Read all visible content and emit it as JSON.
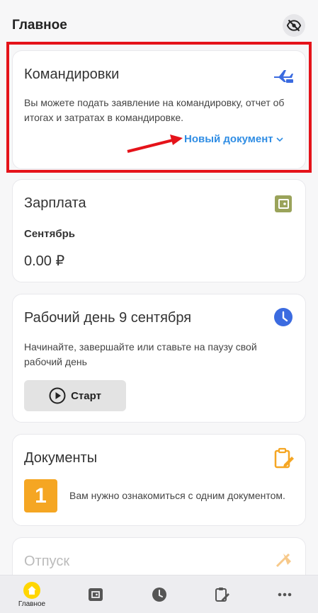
{
  "header": {
    "title": "Главное",
    "eye_icon": "eye-off-icon"
  },
  "trips_card": {
    "title": "Командировки",
    "text": "Вы можете подать заявление на командировку, отчет об итогах и затратах в командировке.",
    "new_doc_label": "Новый документ",
    "icon": "airplane-icon",
    "accent": "#2f8de4"
  },
  "salary_card": {
    "title": "Зарплата",
    "month": "Сентябрь",
    "amount": "0.00 ₽",
    "icon": "wallet-icon",
    "icon_color": "#9aa35a"
  },
  "workday_card": {
    "title": "Рабочий день 9 сентября",
    "text": "Начинайте, завершайте или ставьте на паузу свой рабочий день",
    "start_label": "Старт",
    "icon": "clock-icon",
    "icon_color": "#3b6be0"
  },
  "documents_card": {
    "title": "Документы",
    "count": "1",
    "text": "Вам нужно ознакомиться с одним документом.",
    "icon": "clipboard-edit-icon",
    "badge_color": "#f5a623"
  },
  "vacation_card": {
    "title": "Отпуск",
    "icon": "beach-icon"
  },
  "nav": {
    "home_label": "Главное",
    "items": [
      "home-icon",
      "wallet-icon",
      "clock-icon",
      "clipboard-edit-icon",
      "more-icon"
    ]
  },
  "annotation_color": "#e5131a"
}
